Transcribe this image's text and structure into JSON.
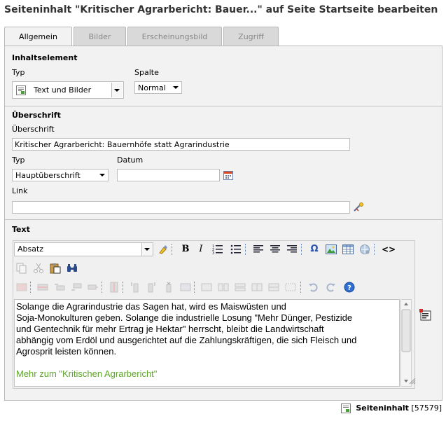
{
  "page_title": "Seiteninhalt \"Kritischer Agrarbericht: Bauer...\" auf Seite Startseite bearbeiten",
  "tabs": [
    {
      "label": "Allgemein",
      "active": true
    },
    {
      "label": "Bilder",
      "active": false
    },
    {
      "label": "Erscheinungsbild",
      "active": false
    },
    {
      "label": "Zugriff",
      "active": false
    }
  ],
  "content_element": {
    "section_title": "Inhaltselement",
    "type_label": "Typ",
    "type_value": "Text und Bilder",
    "column_label": "Spalte",
    "column_value": "Normal"
  },
  "heading": {
    "section_title": "Überschrift",
    "heading_label": "Überschrift",
    "heading_value": "Kritischer Agrarbericht: Bauernhöfe statt Agrarindustrie",
    "type_label": "Typ",
    "type_value": "Hauptüberschrift",
    "date_label": "Datum",
    "date_value": "",
    "link_label": "Link",
    "link_value": ""
  },
  "text": {
    "section_title": "Text",
    "format_value": "Absatz",
    "body_lines": [
      "Solange die Agrarindustrie das Sagen hat, wird es Maiswüsten und",
      "Soja-Monokulturen geben. Solange die industrielle Losung \"Mehr Dünger, Pestizide",
      "und Gentechnik für mehr Ertrag je Hektar\" herrscht, bleibt die Landwirtschaft",
      "abhängig vom Erdöl und ausgerichtet auf die Zahlungskräftigen, die sich Fleisch und",
      "Agrosprit leisten können."
    ],
    "link_text": "Mehr zum \"Kritischen Agrarbericht\"",
    "link_color": "#5ea52a"
  },
  "toolbar": {
    "bold": "B",
    "italic": "I",
    "special_char": "Ω",
    "source": "<>",
    "help": "?"
  },
  "footer": {
    "label": "Seiteninhalt",
    "id": "[57579]"
  },
  "icons": {
    "type_icon": "text-image-content-icon",
    "calendar": "calendar-icon",
    "link_wizard": "link-wizard-icon",
    "fullscreen": "fullscreen-editor-icon"
  }
}
